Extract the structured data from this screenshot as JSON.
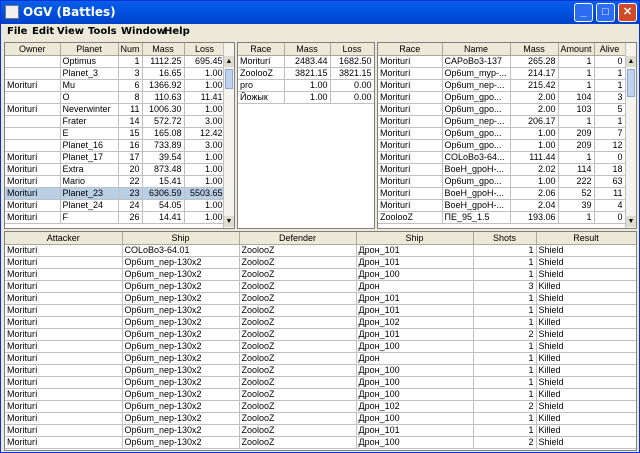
{
  "window": {
    "title": "OGV (Battles)",
    "buttons": [
      "_",
      "□",
      "✕"
    ]
  },
  "menu": [
    "File",
    "Edit",
    "View",
    "Tools",
    "Window",
    "Help"
  ],
  "planets": {
    "columns": [
      "Owner",
      "Planet",
      "Num",
      "Mass",
      "Loss"
    ],
    "rows": [
      [
        "",
        "Optimus",
        "1",
        "1112.25",
        "695.45"
      ],
      [
        "",
        "Planet_3",
        "3",
        "16.65",
        "1.00"
      ],
      [
        "Moriturí",
        "Mu",
        "6",
        "1366.92",
        "1.00"
      ],
      [
        "",
        "O",
        "8",
        "110.63",
        "11.41"
      ],
      [
        "Moriturí",
        "Neverwinter",
        "11",
        "1006.30",
        "1.00"
      ],
      [
        "",
        "Frater",
        "14",
        "572.72",
        "3.00"
      ],
      [
        "",
        "E",
        "15",
        "165.08",
        "12.42"
      ],
      [
        "",
        "Planet_16",
        "16",
        "733.89",
        "3.00"
      ],
      [
        "Moriturí",
        "Planet_17",
        "17",
        "39.54",
        "1.00"
      ],
      [
        "Moriturí",
        "Extra",
        "20",
        "873.48",
        "1.00"
      ],
      [
        "Moriturí",
        "Mario",
        "22",
        "15.41",
        "1.00"
      ],
      [
        "Moriturí",
        "Planet_23",
        "23",
        "6306.59",
        "5503.65"
      ],
      [
        "Moriturí",
        "Planet_24",
        "24",
        "54.05",
        "1.00"
      ],
      [
        "Moriturí",
        "F",
        "26",
        "14.41",
        "1.00"
      ]
    ],
    "selected_row": 11
  },
  "races": {
    "columns": [
      "Race",
      "Mass",
      "Loss"
    ],
    "rows": [
      [
        "Moriturí",
        "2483.44",
        "1682.50"
      ],
      [
        "ZoolooZ",
        "3821.15",
        "3821.15"
      ],
      [
        "pro",
        "1.00",
        "0.00"
      ],
      [
        "Йожык",
        "1.00",
        "0.00"
      ]
    ]
  },
  "groups": {
    "columns": [
      "Race",
      "Name",
      "Mass",
      "Amount",
      "Alive"
    ],
    "rows": [
      [
        "Moriturí",
        "CAPoBo3-137",
        "265.28",
        "1",
        "0"
      ],
      [
        "Moriturí",
        "Op6um_myp-...",
        "214.17",
        "1",
        "1"
      ],
      [
        "Moriturí",
        "Op6um_nep-...",
        "215.42",
        "1",
        "1"
      ],
      [
        "Moriturí",
        "Op6um_gpo...",
        "2.00",
        "104",
        "3"
      ],
      [
        "Moriturí",
        "Op6um_gpo...",
        "2.00",
        "103",
        "5"
      ],
      [
        "Moriturí",
        "Op6um_nep-...",
        "206.17",
        "1",
        "1"
      ],
      [
        "Moriturí",
        "Op6um_gpo...",
        "1.00",
        "209",
        "7"
      ],
      [
        "Moriturí",
        "Op6um_gpo...",
        "1.00",
        "209",
        "12"
      ],
      [
        "Moriturí",
        "COLoBo3-64...",
        "111.44",
        "1",
        "0"
      ],
      [
        "Moriturí",
        "BoeH_gpoH-...",
        "2.02",
        "114",
        "18"
      ],
      [
        "Moriturí",
        "Op6um_gpo...",
        "1.00",
        "222",
        "63"
      ],
      [
        "Moriturí",
        "BoeH_gpoH-...",
        "2.06",
        "52",
        "11"
      ],
      [
        "Moriturí",
        "BoeH_gpoH-...",
        "2.04",
        "39",
        "4"
      ],
      [
        "ZoolooZ",
        "ПЕ_95_1.5",
        "193.06",
        "1",
        "0"
      ]
    ]
  },
  "shots": {
    "columns": [
      "Attacker",
      "Ship",
      "Defender",
      "Ship",
      "Shots",
      "Result"
    ],
    "rows": [
      [
        "Moriturí",
        "COLoBo3-64.01",
        "ZoolooZ",
        "Дрон_101",
        "1",
        "Shield"
      ],
      [
        "Moriturí",
        "Op6um_nep-130x2",
        "ZoolooZ",
        "Дрон_101",
        "1",
        "Shield"
      ],
      [
        "Moriturí",
        "Op6um_nep-130x2",
        "ZoolooZ",
        "Дрон_100",
        "1",
        "Shield"
      ],
      [
        "Moriturí",
        "Op6um_nep-130x2",
        "ZoolooZ",
        "Дрон",
        "3",
        "Killed"
      ],
      [
        "Moriturí",
        "Op6um_nep-130x2",
        "ZoolooZ",
        "Дрон_101",
        "1",
        "Shield"
      ],
      [
        "Moriturí",
        "Op6um_nep-130x2",
        "ZoolooZ",
        "Дрон_101",
        "1",
        "Shield"
      ],
      [
        "Moriturí",
        "Op6um_nep-130x2",
        "ZoolooZ",
        "Дрон_102",
        "1",
        "Killed"
      ],
      [
        "Moriturí",
        "Op6um_nep-130x2",
        "ZoolooZ",
        "Дрон_101",
        "2",
        "Shield"
      ],
      [
        "Moriturí",
        "Op6um_nep-130x2",
        "ZoolooZ",
        "Дрон_100",
        "1",
        "Shield"
      ],
      [
        "Moriturí",
        "Op6um_nep-130x2",
        "ZoolooZ",
        "Дрон",
        "1",
        "Killed"
      ],
      [
        "Moriturí",
        "Op6um_nep-130x2",
        "ZoolooZ",
        "Дрон_100",
        "1",
        "Killed"
      ],
      [
        "Moriturí",
        "Op6um_nep-130x2",
        "ZoolooZ",
        "Дрон_100",
        "1",
        "Shield"
      ],
      [
        "Moriturí",
        "Op6um_nep-130x2",
        "ZoolooZ",
        "Дрон_100",
        "1",
        "Killed"
      ],
      [
        "Moriturí",
        "Op6um_nep-130x2",
        "ZoolooZ",
        "Дрон_102",
        "2",
        "Shield"
      ],
      [
        "Moriturí",
        "Op6um_nep-130x2",
        "ZoolooZ",
        "Дрон_100",
        "1",
        "Killed"
      ],
      [
        "Moriturí",
        "Op6um_nep-130x2",
        "ZoolooZ",
        "Дрон_101",
        "1",
        "Killed"
      ],
      [
        "Moriturí",
        "Op6um_nep-130x2",
        "ZoolooZ",
        "Дрон_100",
        "2",
        "Shield"
      ]
    ]
  }
}
